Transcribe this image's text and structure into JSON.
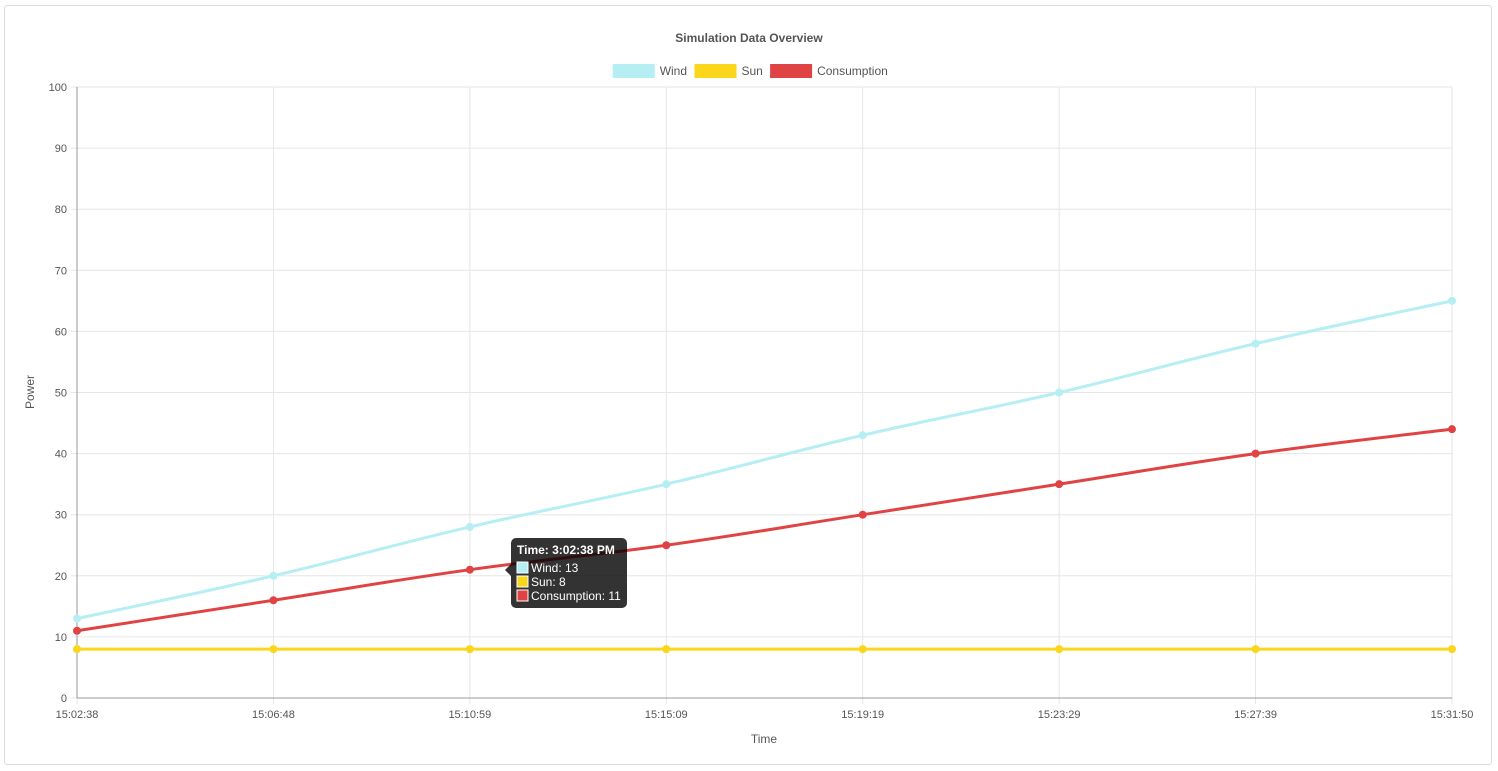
{
  "chart_data": {
    "type": "line",
    "title": "Simulation Data Overview",
    "xlabel": "Time",
    "ylabel": "Power",
    "x": [
      "15:02:38",
      "15:06:48",
      "15:10:59",
      "15:15:09",
      "15:19:19",
      "15:23:29",
      "15:27:39",
      "15:31:50"
    ],
    "ylim": [
      0,
      100
    ],
    "yticks": [
      0,
      10,
      20,
      30,
      40,
      50,
      60,
      70,
      80,
      90,
      100
    ],
    "grid": true,
    "legend_position": "top-center",
    "series": [
      {
        "name": "Wind",
        "color": "#b5eef3",
        "values": [
          13,
          20,
          28,
          35,
          43,
          50,
          58,
          65
        ]
      },
      {
        "name": "Sun",
        "color": "#fad61d",
        "values": [
          8,
          8,
          8,
          8,
          8,
          8,
          8,
          8
        ]
      },
      {
        "name": "Consumption",
        "color": "#e04343",
        "values": [
          11,
          16,
          21,
          25,
          30,
          35,
          40,
          44
        ]
      }
    ],
    "tooltip": {
      "title": "Time: 3:02:38 PM",
      "lines": [
        "Wind: 13",
        "Sun: 8",
        "Consumption: 11"
      ]
    }
  }
}
